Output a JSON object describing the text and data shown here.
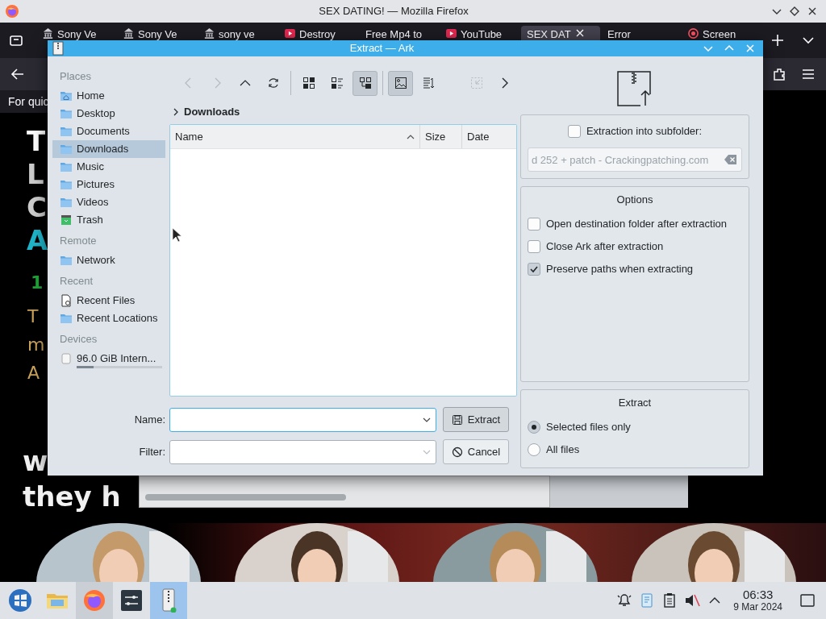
{
  "browser": {
    "title": "SEX DATING! — Mozilla Firefox",
    "tabs": [
      {
        "label": "Sony Ve",
        "selected": false,
        "kind": "building"
      },
      {
        "label": "Sony Ve",
        "selected": false,
        "kind": "building"
      },
      {
        "label": "sony ve",
        "selected": false,
        "kind": "building"
      },
      {
        "label": "Destroy",
        "selected": false,
        "kind": "video"
      },
      {
        "label": "Free Mp4 to",
        "selected": false,
        "kind": "plain"
      },
      {
        "label": "YouTube",
        "selected": false,
        "kind": "video"
      },
      {
        "label": "SEX DAT",
        "selected": true,
        "kind": "plain"
      },
      {
        "label": "Error",
        "selected": false,
        "kind": "plain"
      },
      {
        "label": "Screen",
        "selected": false,
        "kind": "record"
      }
    ],
    "notice": "For quic",
    "big_letters": [
      {
        "text": "T",
        "color": "#ffffff"
      },
      {
        "text": "L",
        "color": "#cccccc"
      },
      {
        "text": "C",
        "color": "#cccccc"
      },
      {
        "text": "A",
        "color": "#1fb5c9"
      }
    ],
    "number": "1",
    "small_letters": [
      "T",
      "m",
      "A"
    ],
    "headline": [
      "w",
      "they h"
    ],
    "photos": [
      {
        "kind": "picture"
      },
      {
        "kind": "picture"
      },
      {
        "kind": "picture"
      },
      {
        "kind": "picture"
      }
    ]
  },
  "dialog": {
    "title": "Extract — Ark",
    "places": [
      {
        "heading": "Places",
        "items": [
          {
            "label": "Home",
            "kind": "home",
            "selected": false
          },
          {
            "label": "Desktop",
            "kind": "folder",
            "selected": false
          },
          {
            "label": "Documents",
            "kind": "folder",
            "selected": false
          },
          {
            "label": "Downloads",
            "kind": "folder",
            "selected": true
          },
          {
            "label": "Music",
            "kind": "folder",
            "selected": false
          },
          {
            "label": "Pictures",
            "kind": "folder",
            "selected": false
          },
          {
            "label": "Videos",
            "kind": "folder",
            "selected": false
          },
          {
            "label": "Trash",
            "kind": "trash",
            "selected": false
          }
        ]
      },
      {
        "heading": "Remote",
        "items": [
          {
            "label": "Network",
            "kind": "folder",
            "selected": false
          }
        ]
      },
      {
        "heading": "Recent",
        "items": [
          {
            "label": "Recent Files",
            "kind": "document",
            "selected": false
          },
          {
            "label": "Recent Locations",
            "kind": "folder",
            "selected": false
          }
        ]
      },
      {
        "heading": "Devices",
        "items": [
          {
            "label": "96.0 GiB Intern...",
            "kind": "drive",
            "selected": false,
            "level": 0.2
          }
        ]
      }
    ],
    "toolbar": [
      [
        {
          "kind": "back",
          "disabled": true,
          "selected": false
        },
        {
          "kind": "forward",
          "disabled": true,
          "selected": false
        },
        {
          "kind": "up",
          "disabled": false,
          "selected": false
        },
        {
          "kind": "reload",
          "disabled": false,
          "selected": false
        }
      ],
      [
        {
          "kind": "icons-view",
          "disabled": false,
          "selected": false
        },
        {
          "kind": "compact-view",
          "disabled": false,
          "selected": false
        },
        {
          "kind": "tree-view",
          "disabled": false,
          "selected": true
        }
      ],
      [
        {
          "kind": "preview",
          "disabled": false,
          "selected": true
        },
        {
          "kind": "sort",
          "disabled": false,
          "selected": false
        },
        {
          "kind": "shrink",
          "disabled": true,
          "selected": false
        },
        {
          "kind": "more",
          "disabled": false,
          "selected": false
        }
      ]
    ],
    "breadcrumb": "Downloads",
    "columns": [
      {
        "label": "Name",
        "sorted": true
      },
      {
        "label": "Size",
        "sorted": false
      },
      {
        "label": "Date",
        "sorted": false
      }
    ],
    "name_label": "Name:",
    "filter_label": "Filter:",
    "buttons": [
      {
        "label": "Extract",
        "kind": "save"
      },
      {
        "label": "Cancel",
        "kind": "cancel"
      }
    ],
    "subfolder": {
      "label": "Extraction into subfolder:",
      "checked": false,
      "value": "d 252 + patch - Crackingpatching.com",
      "disabled": true
    },
    "options": {
      "title": "Options",
      "items": [
        {
          "label": "Open destination folder after extraction",
          "checked": false
        },
        {
          "label": "Close Ark after extraction",
          "checked": false
        },
        {
          "label": "Preserve paths when extracting",
          "checked": true
        }
      ]
    },
    "extract": {
      "title": "Extract",
      "items": [
        {
          "label": "Selected files only",
          "selected": true
        },
        {
          "label": "All files",
          "selected": false
        }
      ]
    }
  },
  "taskbar": {
    "apps": [
      {
        "kind": "start",
        "highlighted": false,
        "selected": false
      },
      {
        "kind": "files",
        "highlighted": false,
        "selected": false
      },
      {
        "kind": "firefox",
        "highlighted": true,
        "selected": false
      },
      {
        "kind": "settings",
        "highlighted": false,
        "selected": false
      },
      {
        "kind": "ark",
        "highlighted": false,
        "selected": true
      }
    ],
    "tray": [
      {
        "kind": "bell"
      },
      {
        "kind": "notes"
      },
      {
        "kind": "clipboard"
      },
      {
        "kind": "muted"
      },
      {
        "kind": "expand"
      }
    ],
    "time": "06:33",
    "date": "9 Mar 2024"
  }
}
